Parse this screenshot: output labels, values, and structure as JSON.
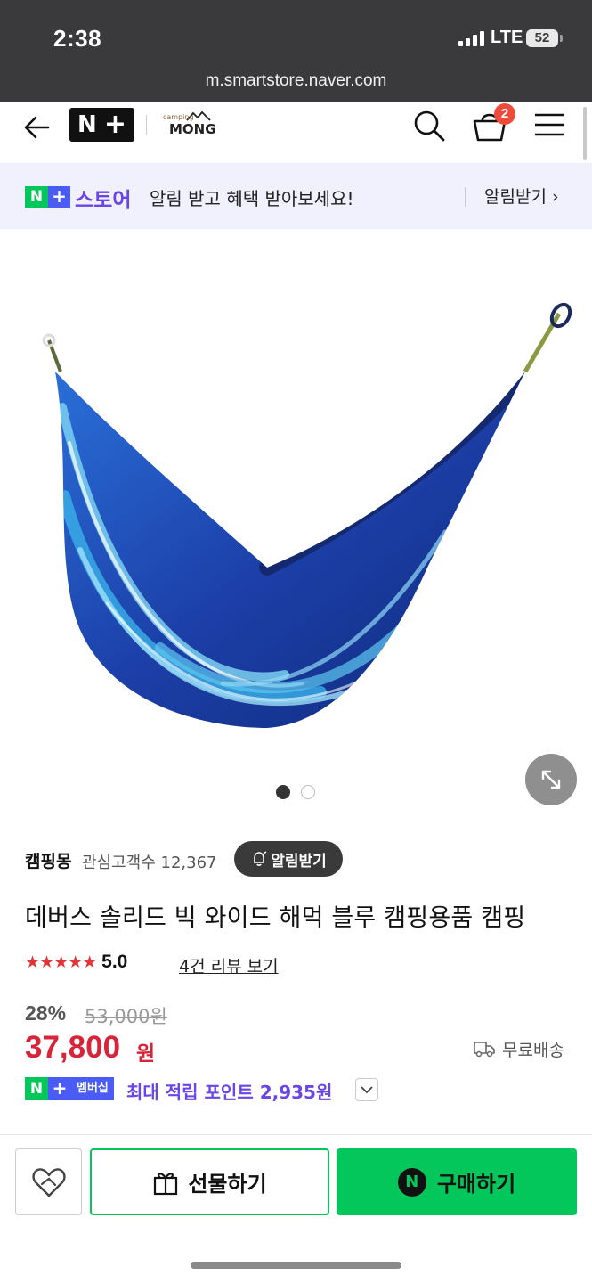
{
  "status_bar": {
    "time": "2:38",
    "network": "LTE",
    "battery": "52",
    "url": "m.smartstore.naver.com"
  },
  "header": {
    "logo_letter": "N",
    "logo_plus": "+",
    "store_logo_small": "camping",
    "store_logo_main": "MONG",
    "cart_count": "2",
    "icons": [
      "back-arrow-icon",
      "search-icon",
      "cart-icon",
      "menu-icon"
    ]
  },
  "promo": {
    "badge_n": "N",
    "badge_plus": "+",
    "brand": "스토어",
    "message": "알림 받고 혜택 받아보세요!",
    "link": "알림받기 ›"
  },
  "gallery": {
    "total_images": 2,
    "current_index": 1
  },
  "product": {
    "seller_name": "캠핑몽",
    "followers": "관심고객수 12,367",
    "alert_button": "알림받기",
    "title": "데버스 솔리드 빅 와이드 해먹 블루 캠핑용품 캠핑",
    "stars": "★★★★★",
    "rating": "5.0",
    "reviews": "4건 리뷰 보기",
    "discount": "28%",
    "original_price": "53,000원",
    "price": "37,800",
    "currency": "원",
    "shipping": "무료배송",
    "member_badge": "멤버십",
    "points": "최대 적립 포인트 2,935원"
  },
  "actions": {
    "gift": "선물하기",
    "buy": "구매하기",
    "buy_badge": "N"
  },
  "colors": {
    "naver_green": "#03c75a",
    "accent_purple": "#6a45e8",
    "price_red": "#d7243a"
  }
}
